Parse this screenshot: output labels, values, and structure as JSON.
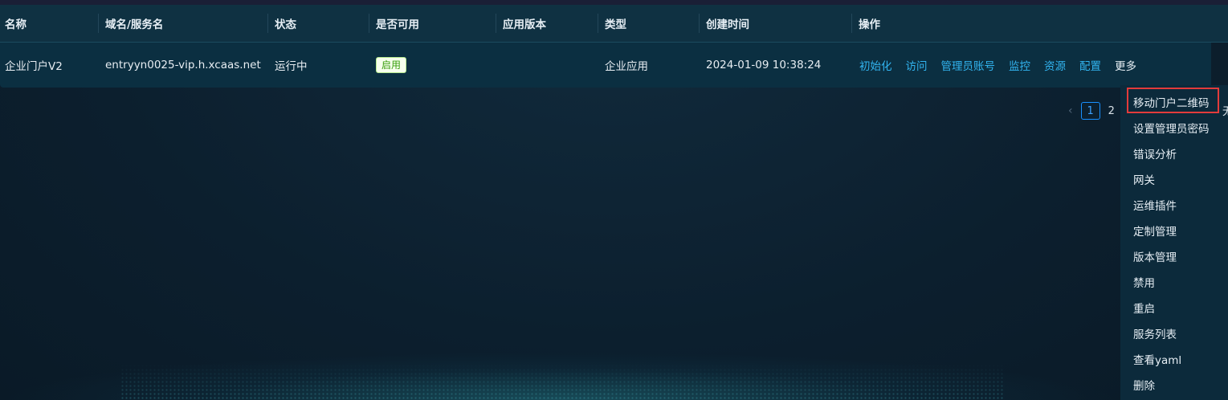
{
  "table": {
    "headers": [
      "名称",
      "域名/服务名",
      "状态",
      "是否可用",
      "应用版本",
      "类型",
      "创建时间",
      "操作"
    ],
    "row": {
      "name": "企业门户V2",
      "domain": "entryyn0025-vip.h.xcaas.net",
      "status": "运行中",
      "available": "启用",
      "version": "",
      "type": "企业应用",
      "created": "2024-01-09 10:38:24",
      "ops": [
        "初始化",
        "访问",
        "管理员账号",
        "监控",
        "资源",
        "配置",
        "更多"
      ]
    }
  },
  "pagination": {
    "prev_icon": "chevron-left-icon",
    "current": "1",
    "next": "2"
  },
  "more_menu": {
    "items": [
      "移动门户二维码",
      "设置管理员密码",
      "错误分析",
      "网关",
      "运维插件",
      "定制管理",
      "版本管理",
      "禁用",
      "重启",
      "服务列表",
      "查看yaml",
      "删除"
    ],
    "edge_text": "无"
  },
  "colors": {
    "link": "#32b4f0",
    "highlight_border": "#e23b3b",
    "tag_green": "#389e0d",
    "pager_active": "#1890ff"
  }
}
